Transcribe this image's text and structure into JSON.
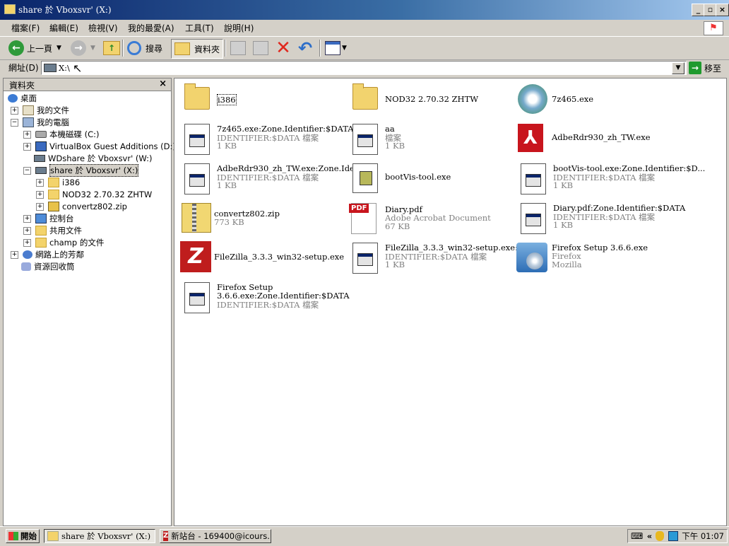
{
  "window": {
    "title": "share 於 Vboxsvr' (X:)"
  },
  "menu": [
    "檔案(F)",
    "編輯(E)",
    "檢視(V)",
    "我的最愛(A)",
    "工具(T)",
    "說明(H)"
  ],
  "toolbar": {
    "back_label": "上一頁",
    "search_label": "搜尋",
    "folders_label": "資料夾"
  },
  "address": {
    "label": "網址(D)",
    "value": "X:\\",
    "go_label": "移至"
  },
  "folders_pane": {
    "title": "資料夾",
    "tree": [
      {
        "label": "桌面",
        "icon": "desktop-icon"
      },
      {
        "label": "我的文件",
        "icon": "my-documents-icon"
      },
      {
        "label": "我的電腦",
        "icon": "my-computer-icon"
      },
      {
        "label": "本機磁碟 (C:)",
        "icon": "local-disk-icon"
      },
      {
        "label": "VirtualBox Guest Additions (D:)",
        "icon": "cd-drive-icon"
      },
      {
        "label": "WDshare 於 Vboxsvr' (W:)",
        "icon": "network-share-icon"
      },
      {
        "label": "share 於 Vboxsvr' (X:)",
        "icon": "network-share-icon"
      },
      {
        "label": "i386",
        "icon": "folder-icon"
      },
      {
        "label": "NOD32 2.70.32 ZHTW",
        "icon": "folder-icon"
      },
      {
        "label": "convertz802.zip",
        "icon": "zip-icon"
      },
      {
        "label": "控制台",
        "icon": "control-panel-icon"
      },
      {
        "label": "共用文件",
        "icon": "folder-icon"
      },
      {
        "label": "champ 的文件",
        "icon": "folder-icon"
      },
      {
        "label": "網路上的芳鄰",
        "icon": "network-icon"
      },
      {
        "label": "資源回收筒",
        "icon": "recycle-bin-icon"
      }
    ]
  },
  "files": [
    {
      "name": "i386",
      "line2": "",
      "line3": "",
      "icon": "folder-icon"
    },
    {
      "name": "NOD32 2.70.32 ZHTW",
      "line2": "",
      "line3": "",
      "icon": "folder-icon"
    },
    {
      "name": "7z465.exe",
      "line2": "",
      "line3": "",
      "icon": "installer-disc-icon"
    },
    {
      "name": "7z465.exe:Zone.Identifier:$DATA",
      "line2": "IDENTIFIER:$DATA 檔案",
      "line3": "1 KB",
      "icon": "generic-file-icon"
    },
    {
      "name": "aa",
      "line2": "檔案",
      "line3": "1 KB",
      "icon": "generic-file-icon"
    },
    {
      "name": "AdbeRdr930_zh_TW.exe",
      "line2": "",
      "line3": "",
      "icon": "acrobat-icon"
    },
    {
      "name": "AdbeRdr930_zh_TW.exe:Zone.Ide...",
      "line2": "IDENTIFIER:$DATA 檔案",
      "line3": "1 KB",
      "icon": "generic-file-icon"
    },
    {
      "name": "bootVis-tool.exe",
      "line2": "",
      "line3": "",
      "icon": "bootvis-icon"
    },
    {
      "name": "bootVis-tool.exe:Zone.Identifier:$D...",
      "line2": "IDENTIFIER:$DATA 檔案",
      "line3": "1 KB",
      "icon": "generic-file-icon"
    },
    {
      "name": "convertz802.zip",
      "line2": "773 KB",
      "line3": "",
      "icon": "zip-icon"
    },
    {
      "name": "Diary.pdf",
      "line2": "Adobe Acrobat Document",
      "line3": "67 KB",
      "icon": "pdf-icon"
    },
    {
      "name": "Diary.pdf:Zone.Identifier:$DATA",
      "line2": "IDENTIFIER:$DATA 檔案",
      "line3": "1 KB",
      "icon": "generic-file-icon"
    },
    {
      "name": "FileZilla_3.3.3_win32-setup.exe",
      "line2": "",
      "line3": "",
      "icon": "filezilla-icon"
    },
    {
      "name": "FileZilla_3.3.3_win32-setup.exe:Zo...",
      "line2": "IDENTIFIER:$DATA 檔案",
      "line3": "1 KB",
      "icon": "generic-file-icon"
    },
    {
      "name": "Firefox Setup 3.6.6.exe",
      "line2": "Firefox",
      "line3": "Mozilla",
      "icon": "firefox-setup-icon"
    },
    {
      "name": "Firefox Setup",
      "line2": "3.6.6.exe:Zone.Identifier:$DATA",
      "line3": "IDENTIFIER:$DATA 檔案",
      "icon": "generic-file-icon"
    }
  ],
  "taskbar": {
    "start_label": "開始",
    "tasks": [
      "share 於 Vboxsvr' (X:)",
      "新站台 - 169400@icours..."
    ],
    "clock": "下午 01:07"
  }
}
